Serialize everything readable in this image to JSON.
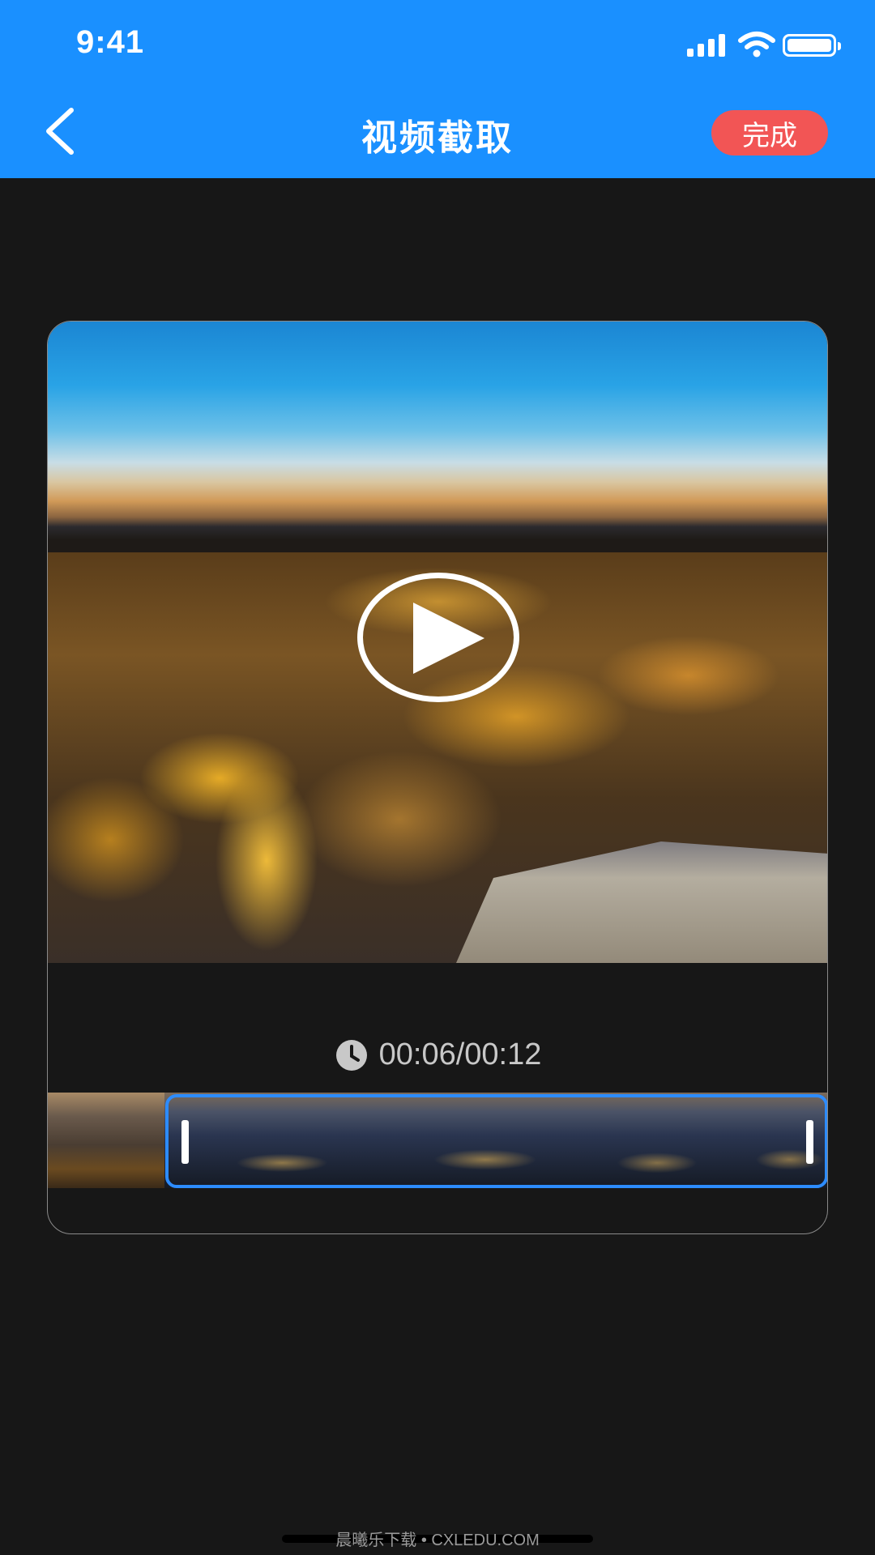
{
  "status_bar": {
    "time": "9:41",
    "icons": [
      "signal-icon",
      "wifi-icon",
      "battery-icon"
    ]
  },
  "header": {
    "title": "视频截取",
    "back_icon": "chevron-left-icon",
    "done_label": "完成",
    "background_color": "#1a90ff",
    "done_color": "#f25555"
  },
  "player": {
    "play_icon": "play-icon",
    "time_icon": "clock-icon",
    "time_display": "00:06/00:12"
  },
  "trimmer": {
    "accent_color": "#2d8cff"
  },
  "watermark": "晨曦乐下载 • CXLEDU.COM"
}
